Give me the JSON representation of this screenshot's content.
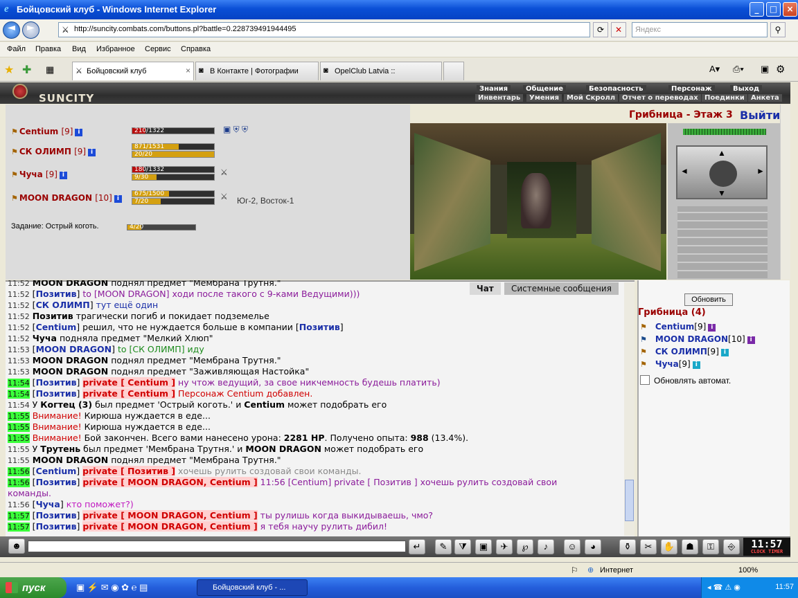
{
  "window": {
    "title": "Бойцовский клуб - Windows Internet Explorer",
    "min_label": "_",
    "max_label": "□",
    "close_label": "×"
  },
  "address": {
    "url": "http://suncity.combats.com/buttons.pl?battle=0.228739491944495",
    "search_placeholder": "Яндекс"
  },
  "menu": [
    "Файл",
    "Правка",
    "Вид",
    "Избранное",
    "Сервис",
    "Справка"
  ],
  "tabs": [
    {
      "label": "Бойцовский клуб",
      "active": true
    },
    {
      "label": "В Контакте | Фотографии",
      "active": false
    },
    {
      "label": "OpelClub Latvia ::",
      "active": false
    }
  ],
  "game": {
    "logo": "SUNCITY",
    "menu_row1": [
      "Знания",
      "Общение",
      "Безопасность",
      "Персонаж",
      "Выход"
    ],
    "menu_row2": [
      "Инвентарь",
      "Умения",
      "Мой Скролл",
      "Отчет о переводах",
      "Поединки",
      "Анкета"
    ],
    "location_title": "Грибница - Этаж 3",
    "exit_label": "Выйти",
    "players": [
      {
        "name": "Centium",
        "level": "[9]",
        "hp_text": "210/1322",
        "hp_frac": 0.16,
        "mp_text": "",
        "mp_frac": 0
      },
      {
        "name": "СК ОЛИМП",
        "level": "[9]",
        "hp_text": "871/1531",
        "hp_frac": 0.57,
        "mp_text": "20/20",
        "mp_frac": 1.0
      },
      {
        "name": "Чуча",
        "level": "[9]",
        "hp_text": "180/1332",
        "hp_frac": 0.14,
        "mp_text": "9/30",
        "mp_frac": 0.3
      },
      {
        "name": "MOON DRAGON",
        "level": "[10]",
        "hp_text": "675/1500",
        "hp_frac": 0.45,
        "mp_text": "7/20",
        "mp_frac": 0.35
      }
    ],
    "coords": "Юг-2, Восток-1",
    "task_label": "Задание: Острый коготь.",
    "task_progress": "4/20",
    "task_frac": 0.2
  },
  "chat": {
    "tabs": [
      "Чат",
      "Системные сообщения"
    ]
  },
  "online": {
    "refresh_label": "Обновить",
    "header": "Грибница (4)",
    "users": [
      {
        "name": "Centium",
        "level": "[9]"
      },
      {
        "name": "MOON DRAGON",
        "level": "[10]"
      },
      {
        "name": "СК ОЛИМП",
        "level": "[9]"
      },
      {
        "name": "Чуча",
        "level": "[9]"
      }
    ],
    "auto_refresh_label": "Обновлять автомат."
  },
  "clock": {
    "time": "11:57",
    "label": "CLOCK TIMER"
  },
  "status": {
    "zone": "Интернет",
    "zoom": "100%"
  },
  "taskbar": {
    "start": "пуск",
    "task": "Бойцовский клуб - ...",
    "time": "11:57"
  }
}
